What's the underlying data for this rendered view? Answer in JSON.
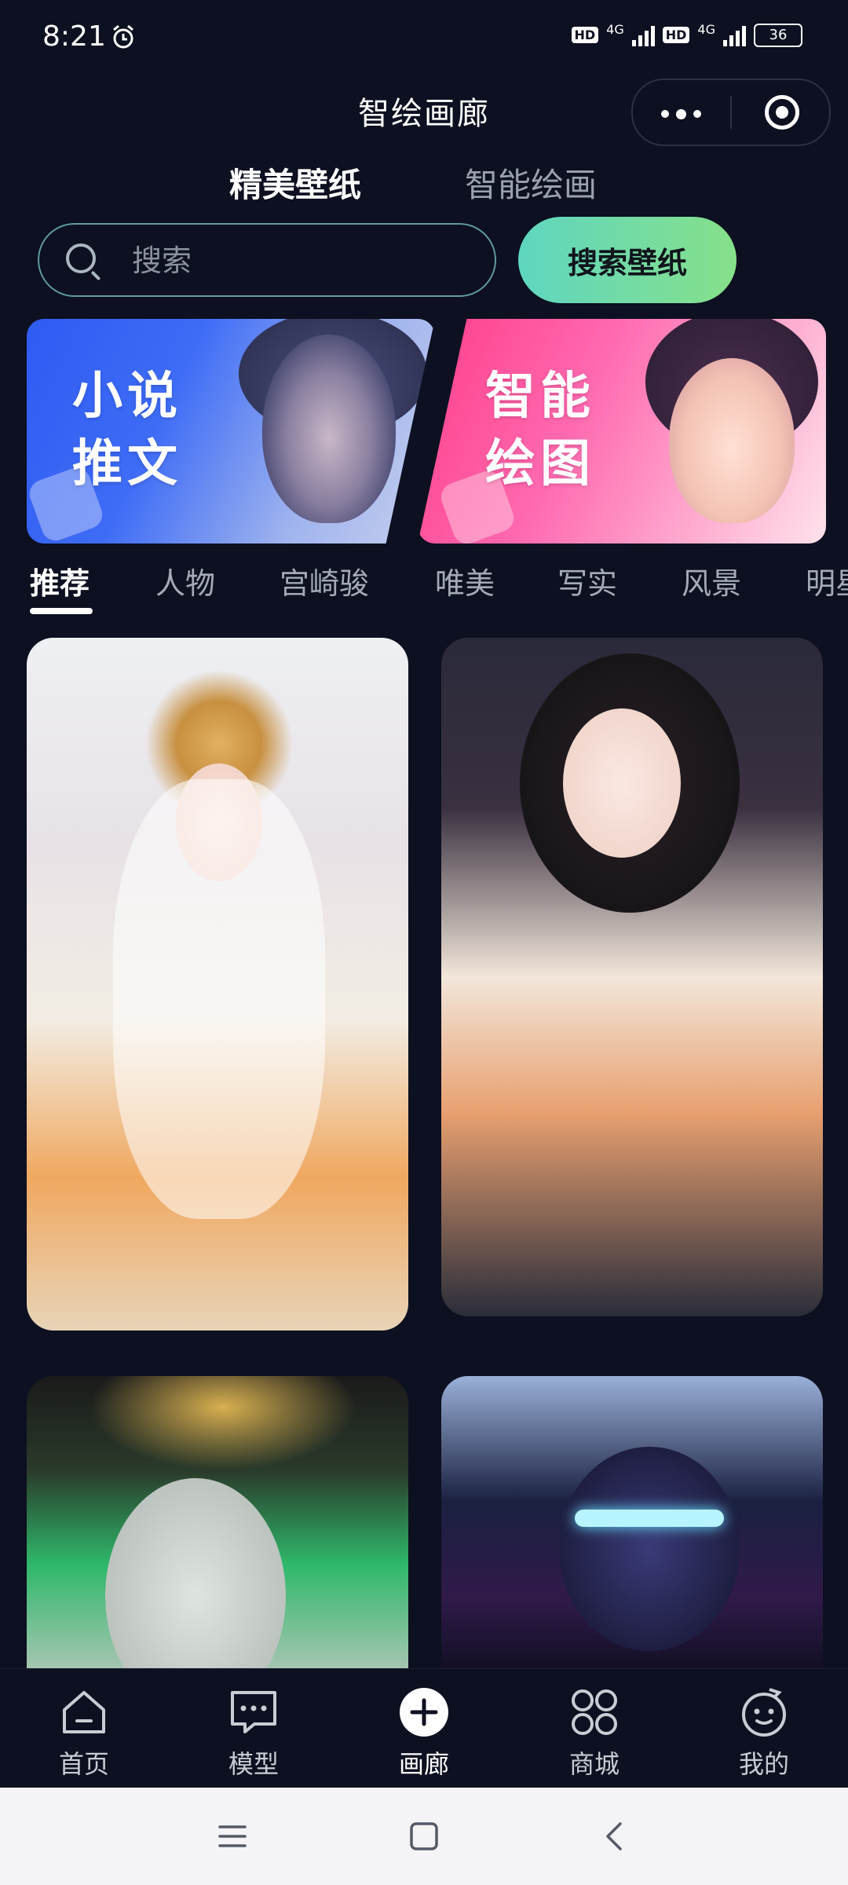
{
  "status_bar": {
    "time": "8:21",
    "network_1": "4G",
    "network_2": "4G",
    "hd_1": "HD",
    "hd_2": "HD",
    "battery": "36"
  },
  "header": {
    "title": "智绘画廊"
  },
  "top_tabs": [
    {
      "label": "精美壁纸",
      "active": true
    },
    {
      "label": "智能绘画",
      "active": false
    }
  ],
  "search": {
    "placeholder": "搜索",
    "value": "",
    "button_label": "搜索壁纸"
  },
  "banners": [
    {
      "line1": "小说",
      "line2": "推文",
      "color": "#2f5bf2"
    },
    {
      "line1": "智能",
      "line2": "绘图",
      "color": "#ff3d8a"
    }
  ],
  "categories": [
    "推荐",
    "人物",
    "宫崎骏",
    "唯美",
    "写实",
    "风景",
    "明星"
  ],
  "active_category": "推荐",
  "bottom_nav": [
    {
      "label": "首页",
      "icon": "home-icon"
    },
    {
      "label": "模型",
      "icon": "chat-bubble-icon"
    },
    {
      "label": "画廊",
      "icon": "plus-circle-icon",
      "active": true
    },
    {
      "label": "商城",
      "icon": "grid-clover-icon"
    },
    {
      "label": "我的",
      "icon": "smiley-face-icon"
    }
  ],
  "colors": {
    "background": "#0c1020",
    "search_border": "#5f9aa0",
    "search_button_gradient_start": "#5fd6c0",
    "search_button_gradient_end": "#86e08a"
  }
}
